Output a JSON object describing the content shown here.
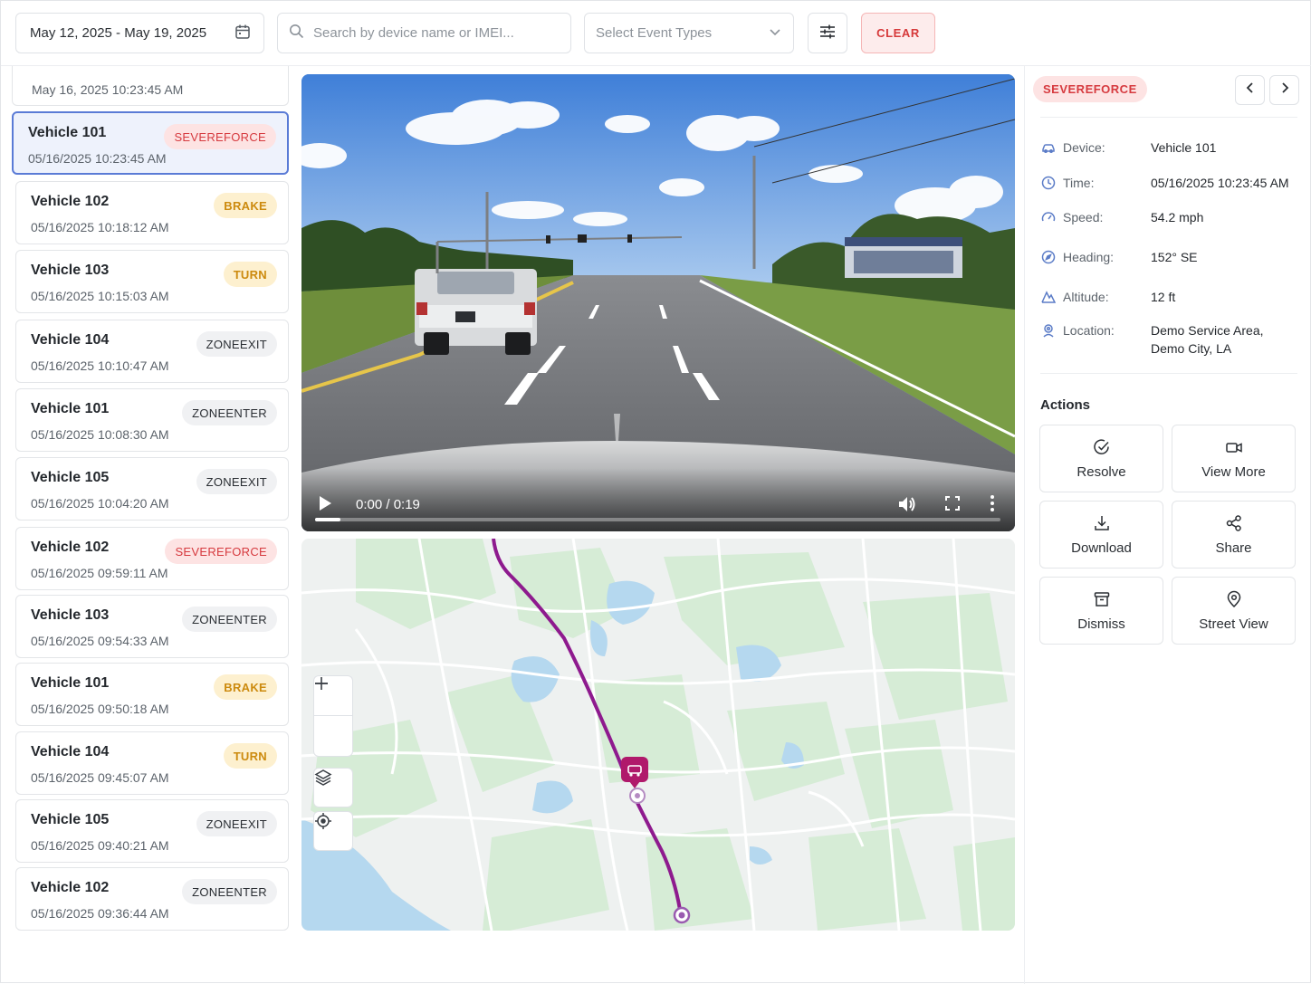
{
  "toolbar": {
    "date_range": "May 12, 2025 - May 19, 2025",
    "search_placeholder": "Search by device name or IMEI...",
    "event_type_placeholder": "Select Event Types",
    "clear_label": "CLEAR"
  },
  "event_list": {
    "header_timestamp": "May 16, 2025 10:23:45 AM",
    "items": [
      {
        "vehicle": "Vehicle 101",
        "timestamp": "05/16/2025 10:23:45 AM",
        "event": "SEVEREFORCE",
        "selected": true
      },
      {
        "vehicle": "Vehicle 102",
        "timestamp": "05/16/2025 10:18:12 AM",
        "event": "BRAKE"
      },
      {
        "vehicle": "Vehicle 103",
        "timestamp": "05/16/2025 10:15:03 AM",
        "event": "TURN"
      },
      {
        "vehicle": "Vehicle 104",
        "timestamp": "05/16/2025 10:10:47 AM",
        "event": "ZONEEXIT"
      },
      {
        "vehicle": "Vehicle 101",
        "timestamp": "05/16/2025 10:08:30 AM",
        "event": "ZONEENTER"
      },
      {
        "vehicle": "Vehicle 105",
        "timestamp": "05/16/2025 10:04:20 AM",
        "event": "ZONEEXIT"
      },
      {
        "vehicle": "Vehicle 102",
        "timestamp": "05/16/2025 09:59:11 AM",
        "event": "SEVEREFORCE"
      },
      {
        "vehicle": "Vehicle 103",
        "timestamp": "05/16/2025 09:54:33 AM",
        "event": "ZONEENTER"
      },
      {
        "vehicle": "Vehicle 101",
        "timestamp": "05/16/2025 09:50:18 AM",
        "event": "BRAKE"
      },
      {
        "vehicle": "Vehicle 104",
        "timestamp": "05/16/2025 09:45:07 AM",
        "event": "TURN"
      },
      {
        "vehicle": "Vehicle 105",
        "timestamp": "05/16/2025 09:40:21 AM",
        "event": "ZONEEXIT"
      },
      {
        "vehicle": "Vehicle 102",
        "timestamp": "05/16/2025 09:36:44 AM",
        "event": "ZONEENTER"
      }
    ]
  },
  "video": {
    "time_display": "0:00 / 0:19",
    "progress_fraction": 0.037
  },
  "map": {
    "zoom_in_label": "+",
    "zoom_out_label": "−"
  },
  "details": {
    "event_badge": "SEVEREFORCE",
    "rows": [
      {
        "icon": "car-icon",
        "label": "Device:",
        "value": "Vehicle 101"
      },
      {
        "icon": "clock-icon",
        "label": "Time:",
        "value": "05/16/2025 10:23:45 AM"
      },
      {
        "icon": "gauge-icon",
        "label": "Speed:",
        "value": "54.2 mph"
      },
      {
        "icon": "compass-icon",
        "label": "Heading:",
        "value": "152° SE"
      },
      {
        "icon": "mountain-icon",
        "label": "Altitude:",
        "value": "12 ft"
      },
      {
        "icon": "location-icon",
        "label": "Location:",
        "value_line1": "Demo Service Area,",
        "value_line2": "Demo City, LA"
      }
    ],
    "actions_title": "Actions",
    "actions": [
      {
        "icon": "check-circle-icon",
        "label": "Resolve"
      },
      {
        "icon": "video-camera-icon",
        "label": "View More"
      },
      {
        "icon": "download-icon",
        "label": "Download"
      },
      {
        "icon": "share-icon",
        "label": "Share"
      },
      {
        "icon": "archive-icon",
        "label": "Dismiss"
      },
      {
        "icon": "map-pin-icon",
        "label": "Street View"
      }
    ]
  },
  "colors": {
    "severe": "#d63a3f",
    "severe_bg": "#fde3e3",
    "warning": "#cc8a0e",
    "warning_bg": "#fdf0cf",
    "selected_border": "#5a7bd6",
    "route": "#8e1a8e"
  }
}
